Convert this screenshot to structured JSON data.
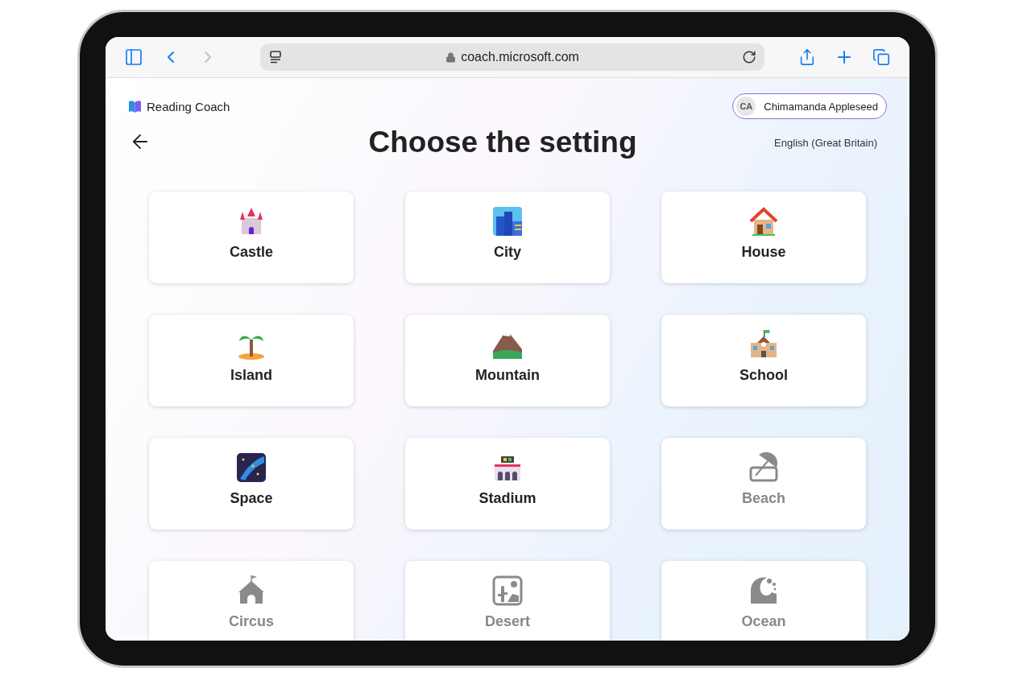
{
  "browser": {
    "address": "coach.microsoft.com"
  },
  "app": {
    "name": "Reading Coach"
  },
  "user": {
    "initials": "CA",
    "name": "Chimamanda Appleseed"
  },
  "page": {
    "title": "Choose the setting",
    "language": "English (Great Britain)"
  },
  "settings": [
    {
      "label": "Castle",
      "available": true
    },
    {
      "label": "City",
      "available": true
    },
    {
      "label": "House",
      "available": true
    },
    {
      "label": "Island",
      "available": true
    },
    {
      "label": "Mountain",
      "available": true
    },
    {
      "label": "School",
      "available": true
    },
    {
      "label": "Space",
      "available": true
    },
    {
      "label": "Stadium",
      "available": true
    },
    {
      "label": "Beach",
      "available": false
    },
    {
      "label": "Circus",
      "available": false
    },
    {
      "label": "Desert",
      "available": false
    },
    {
      "label": "Ocean",
      "available": false
    }
  ]
}
